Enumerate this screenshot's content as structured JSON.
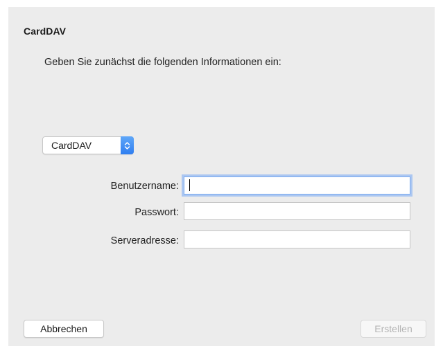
{
  "dialog": {
    "title": "CardDAV",
    "subtitle": "Geben Sie zunächst die folgenden Informationen ein:"
  },
  "account_type": {
    "selected": "CardDAV",
    "stepper_icon": "up-down-chevron-icon",
    "accent": "#2f7ef0"
  },
  "form": {
    "username_label": "Benutzername:",
    "username_value": "",
    "password_label": "Passwort:",
    "password_value": "",
    "server_label": "Serveradresse:",
    "server_value": ""
  },
  "buttons": {
    "cancel": "Abbrechen",
    "create": "Erstellen"
  }
}
